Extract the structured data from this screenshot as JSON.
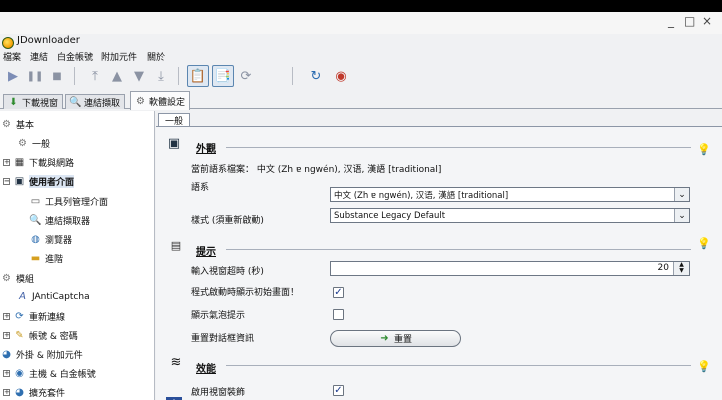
{
  "window": {
    "title": "JDownloader",
    "controls": {
      "minimize": "_",
      "maximize": "□",
      "close": "×"
    }
  },
  "menu": [
    "檔案",
    "連結",
    "白金帳號",
    "附加元件",
    "關於"
  ],
  "toolbar": {
    "buttons": [
      "play-icon",
      "pause-icon",
      "stop-icon",
      "move-top-icon",
      "move-up-icon",
      "move-down-icon",
      "move-bottom-icon",
      "clipboard-icon",
      "clipboard-check-icon",
      "reconnect-icon",
      "refresh-icon",
      "update-icon"
    ]
  },
  "tabs": [
    {
      "label": "下載視窗",
      "icon": "download-arrow-icon"
    },
    {
      "label": "連結擷取",
      "icon": "link-grabber-icon"
    },
    {
      "label": "軟體設定",
      "icon": "settings-gear-icon",
      "active": true
    }
  ],
  "sidebar": {
    "items": [
      {
        "label": "基本",
        "icon": "gear-icon"
      },
      {
        "label": "一般",
        "icon": "gear-small-icon"
      },
      {
        "label": "下載與網路",
        "icon": "network-icon"
      },
      {
        "label": "使用者介面",
        "icon": "monitor-icon"
      },
      {
        "label": "工具列管理介面",
        "icon": "toolbar-icon"
      },
      {
        "label": "連結擷取器",
        "icon": "link-grabber-icon"
      },
      {
        "label": "瀏覽器",
        "icon": "browser-icon"
      },
      {
        "label": "進階",
        "icon": "advanced-icon"
      },
      {
        "label": "模組",
        "icon": "module-gear-icon"
      },
      {
        "label": "JAntiCaptcha",
        "icon": "captcha-icon"
      },
      {
        "label": "重新連線",
        "icon": "reconnect-icon"
      },
      {
        "label": "帳號 & 密碼",
        "icon": "account-icon"
      },
      {
        "label": "外掛 & 附加元件",
        "icon": "plugin-icon"
      },
      {
        "label": "主機 & 白金帳號",
        "icon": "host-icon"
      },
      {
        "label": "擴充套件",
        "icon": "extension-icon"
      }
    ]
  },
  "content": {
    "subtab": "一般",
    "sections": {
      "appearance": {
        "title": "外觀",
        "icon": "monitor-icon"
      },
      "hints": {
        "title": "提示",
        "icon": "keyboard-icon"
      },
      "performance": {
        "title": "效能",
        "icon": "performance-icon"
      }
    },
    "current_language_label": "當前語系檔案：",
    "current_language_value": "中文 (Zh ɐ ngwén), 汉语, 漢語 [traditional]",
    "language_label": "語系",
    "language_value": "中文 (Zh ɐ ngwén), 汉语, 漢語 [traditional]",
    "style_label": "樣式 (須重新啟動)",
    "style_value": "Substance Legacy Default",
    "timeout_label": "輸入視窗超時 (秒)",
    "timeout_value": "20",
    "splash_label": "程式啟動時顯示初始畫面！",
    "splash_checked": true,
    "balloon_label": "顯示氣泡提示",
    "balloon_checked": false,
    "reset_dialogs_label": "重置對話框資訊",
    "reset_button": "重置",
    "decorations_label": "啟用視窗裝飾",
    "decorations_checked": true
  },
  "colors": {
    "accent": "#1c3b8e",
    "selection": "#dce6f3",
    "panel": "#f4f5f7"
  }
}
